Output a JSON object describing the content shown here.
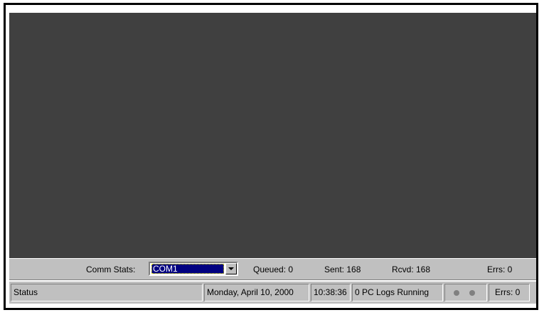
{
  "comm": {
    "label": "Comm Stats:",
    "port": "COM1",
    "queued": "Queued:  0",
    "sent": "Sent:  168",
    "rcvd": "Rcvd:  168",
    "errs": "Errs:  0"
  },
  "status": {
    "text": "Status",
    "date": "Monday, April 10, 2000",
    "time": "10:38:36",
    "logs": "0 PC Logs Running",
    "errs": "Errs: 0"
  }
}
